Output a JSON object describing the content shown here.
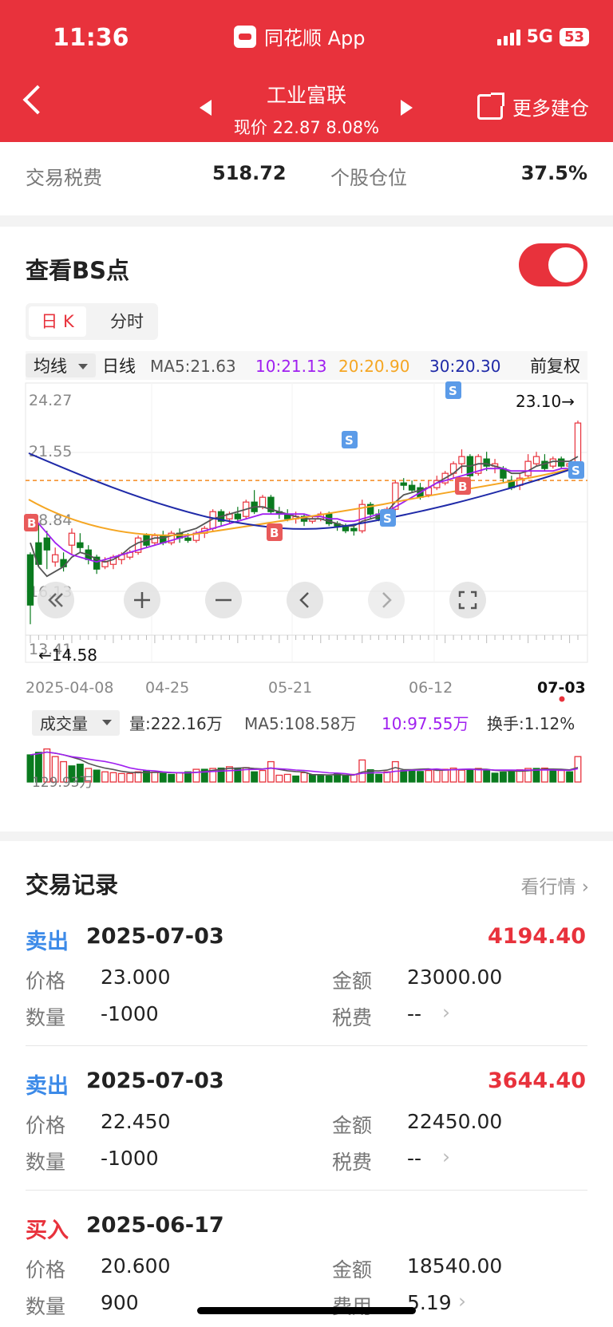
{
  "status_bar": {
    "time": "11:36",
    "app_name": "同花顺 App",
    "network": "5G",
    "battery": "53"
  },
  "header": {
    "stock_name": "工业富联",
    "price_line": "现价 22.87 8.08%",
    "more_label": "更多建仓"
  },
  "stats": {
    "tax_label": "交易税费",
    "tax_value": "518.72",
    "position_label": "个股仓位",
    "position_value": "37.5%"
  },
  "bs_section": {
    "title": "查看BS点",
    "tab_day": "日 K",
    "tab_time": "分时"
  },
  "ma_bar": {
    "avg_label": "均线",
    "period_label": "日线",
    "ma5": "MA5:21.63",
    "ma10": "10:21.13",
    "ma20": "20:20.90",
    "ma30": "30:20.30",
    "adjust_label": "前复权"
  },
  "price_axis": {
    "labels": [
      "24.27",
      "21.55",
      "18.84",
      "16.13",
      "13.41"
    ]
  },
  "annotations": {
    "high": "23.10→",
    "low": "←14.58"
  },
  "date_axis": {
    "labels": [
      "2025-04-08",
      "04-25",
      "05-21",
      "06-12",
      "07-03"
    ]
  },
  "volume_bar": {
    "label": "成交量",
    "volume": "量:222.16万",
    "ma5": "MA5:108.58万",
    "ma10": "10:97.55万",
    "turnover": "换手:1.12%",
    "axis_label": "129.93万"
  },
  "colors": {
    "up": "#e8323c",
    "down": "#0a7a1e",
    "ma5": "#555555",
    "ma10": "#a020f0",
    "ma20": "#f5a623",
    "ma30": "#1f2aa8",
    "buy": "#e85a5a",
    "sell": "#5b9be8"
  },
  "chart_data": {
    "type": "candlestick",
    "start_date": "2025-04-08",
    "end_date": "2025-07-03",
    "price_range": [
      13.41,
      24.27
    ],
    "reference_price": 20.6,
    "candles": [
      [
        17.5,
        15.4,
        17.6,
        14.6
      ],
      [
        18.0,
        17.1,
        18.8,
        17.0
      ],
      [
        18.2,
        17.7,
        18.5,
        16.9
      ],
      [
        17.2,
        17.5,
        17.8,
        17.0
      ],
      [
        17.3,
        17.0,
        17.6,
        16.8
      ],
      [
        17.9,
        18.4,
        18.6,
        17.5
      ],
      [
        18.0,
        17.8,
        18.4,
        17.6
      ],
      [
        17.7,
        17.3,
        17.9,
        17.1
      ],
      [
        17.4,
        16.9,
        17.5,
        16.7
      ],
      [
        17.0,
        17.2,
        17.4,
        16.9
      ],
      [
        17.1,
        17.4,
        17.5,
        16.9
      ],
      [
        17.3,
        17.5,
        17.6,
        17.1
      ],
      [
        17.4,
        17.6,
        17.7,
        17.3
      ],
      [
        17.6,
        18.2,
        18.3,
        17.5
      ],
      [
        18.3,
        17.9,
        18.4,
        17.8
      ],
      [
        18.0,
        18.3,
        18.4,
        17.9
      ],
      [
        18.3,
        18.0,
        18.5,
        17.9
      ],
      [
        18.0,
        18.4,
        18.5,
        17.9
      ],
      [
        18.4,
        18.2,
        18.6,
        18.0
      ],
      [
        18.2,
        18.1,
        18.4,
        18.0
      ],
      [
        18.1,
        18.4,
        18.5,
        18.0
      ],
      [
        18.4,
        18.6,
        18.7,
        18.2
      ],
      [
        18.6,
        19.3,
        19.4,
        18.5
      ],
      [
        19.3,
        18.9,
        19.4,
        18.7
      ],
      [
        19.0,
        19.2,
        19.3,
        18.8
      ],
      [
        19.2,
        19.0,
        19.5,
        18.9
      ],
      [
        19.1,
        19.7,
        19.8,
        19.0
      ],
      [
        19.7,
        19.3,
        20.2,
        19.2
      ],
      [
        19.5,
        19.9,
        20.0,
        19.4
      ],
      [
        19.9,
        19.3,
        20.0,
        19.2
      ],
      [
        19.3,
        19.2,
        19.5,
        19.0
      ],
      [
        19.2,
        19.0,
        19.4,
        18.9
      ],
      [
        19.0,
        19.1,
        19.3,
        18.8
      ],
      [
        19.1,
        18.9,
        19.2,
        18.7
      ],
      [
        18.9,
        19.0,
        19.1,
        18.8
      ],
      [
        19.0,
        19.2,
        19.3,
        18.9
      ],
      [
        19.2,
        18.8,
        19.3,
        18.7
      ],
      [
        18.8,
        18.7,
        18.9,
        18.5
      ],
      [
        18.7,
        18.5,
        18.8,
        18.4
      ],
      [
        18.6,
        18.5,
        18.7,
        18.3
      ],
      [
        18.5,
        19.6,
        19.8,
        18.4
      ],
      [
        19.6,
        19.2,
        19.7,
        19.0
      ],
      [
        19.2,
        19.0,
        19.4,
        18.9
      ],
      [
        19.1,
        19.4,
        19.5,
        19.0
      ],
      [
        19.4,
        20.5,
        20.6,
        19.3
      ],
      [
        20.5,
        20.4,
        20.7,
        20.2
      ],
      [
        20.4,
        20.2,
        20.6,
        20.1
      ],
      [
        20.3,
        19.9,
        20.5,
        19.8
      ],
      [
        20.0,
        20.3,
        20.6,
        19.9
      ],
      [
        20.3,
        20.6,
        20.8,
        20.2
      ],
      [
        20.5,
        20.9,
        21.0,
        20.4
      ],
      [
        20.9,
        21.3,
        21.4,
        20.7
      ],
      [
        21.3,
        21.6,
        21.9,
        20.9
      ],
      [
        21.6,
        20.8,
        21.7,
        20.7
      ],
      [
        20.9,
        21.6,
        21.7,
        20.8
      ],
      [
        21.5,
        21.2,
        21.8,
        21.0
      ],
      [
        21.2,
        21.3,
        21.5,
        20.9
      ],
      [
        21.1,
        20.7,
        21.2,
        20.5
      ],
      [
        20.6,
        20.3,
        20.8,
        20.2
      ],
      [
        20.4,
        20.7,
        20.9,
        20.2
      ],
      [
        20.8,
        21.4,
        21.7,
        20.7
      ],
      [
        21.3,
        21.6,
        21.8,
        21.2
      ],
      [
        21.4,
        21.1,
        21.7,
        21.0
      ],
      [
        21.2,
        21.5,
        21.6,
        21.1
      ],
      [
        21.5,
        21.2,
        21.6,
        21.1
      ],
      [
        21.2,
        21.3,
        21.4,
        21.1
      ],
      [
        21.3,
        23.0,
        23.1,
        21.2
      ]
    ],
    "ma": {
      "ma5": [
        18.0,
        17.0,
        16.6,
        16.8,
        17.0,
        17.4,
        17.6,
        17.5,
        17.3,
        17.2,
        17.3,
        17.5,
        17.8,
        18.0,
        18.1,
        18.2,
        18.2,
        18.3,
        18.4,
        18.5,
        18.6,
        18.8,
        19.0,
        19.1,
        19.2,
        19.3,
        19.4,
        19.5,
        19.5,
        19.4,
        19.3,
        19.2,
        19.1,
        19.0,
        19.0,
        19.0,
        18.9,
        18.8,
        18.7,
        18.7,
        18.9,
        19.0,
        19.1,
        19.3,
        19.7,
        20.0,
        20.1,
        20.2,
        20.3,
        20.5,
        20.7,
        20.9,
        21.2,
        21.2,
        21.3,
        21.3,
        21.2,
        21.1,
        20.9,
        20.9,
        21.0,
        21.2,
        21.3,
        21.4,
        21.4,
        21.4,
        21.6
      ],
      "ma10": [
        19.2,
        18.8,
        18.4,
        18.0,
        17.7,
        17.5,
        17.4,
        17.3,
        17.2,
        17.3,
        17.4,
        17.5,
        17.6,
        17.7,
        17.8,
        17.9,
        18.0,
        18.1,
        18.2,
        18.3,
        18.4,
        18.5,
        18.6,
        18.7,
        18.8,
        18.9,
        19.0,
        19.1,
        19.2,
        19.2,
        19.2,
        19.2,
        19.2,
        19.2,
        19.1,
        19.1,
        19.0,
        19.0,
        18.9,
        18.9,
        19.0,
        19.1,
        19.2,
        19.3,
        19.5,
        19.7,
        19.9,
        20.1,
        20.3,
        20.5,
        20.6,
        20.7,
        20.8,
        20.9,
        21.0,
        21.1,
        21.1,
        21.1,
        21.0,
        21.0,
        21.0,
        21.0,
        21.0,
        21.0,
        21.1,
        21.1,
        21.13
      ]
    },
    "volume_range": [
      0,
      245
    ],
    "volumes": [
      [
        160,
        0
      ],
      [
        175,
        0
      ],
      [
        195,
        1
      ],
      [
        150,
        1
      ],
      [
        120,
        1
      ],
      [
        95,
        0
      ],
      [
        105,
        0
      ],
      [
        80,
        1
      ],
      [
        70,
        0
      ],
      [
        60,
        1
      ],
      [
        55,
        1
      ],
      [
        50,
        1
      ],
      [
        50,
        1
      ],
      [
        60,
        1
      ],
      [
        65,
        0
      ],
      [
        58,
        1
      ],
      [
        50,
        0
      ],
      [
        45,
        0
      ],
      [
        55,
        1
      ],
      [
        60,
        0
      ],
      [
        75,
        1
      ],
      [
        75,
        0
      ],
      [
        80,
        1
      ],
      [
        82,
        0
      ],
      [
        90,
        1
      ],
      [
        82,
        0
      ],
      [
        85,
        1
      ],
      [
        60,
        0
      ],
      [
        68,
        1
      ],
      [
        120,
        1
      ],
      [
        40,
        1
      ],
      [
        45,
        1
      ],
      [
        35,
        0
      ],
      [
        55,
        1
      ],
      [
        42,
        0
      ],
      [
        40,
        0
      ],
      [
        35,
        0
      ],
      [
        50,
        0
      ],
      [
        35,
        0
      ],
      [
        45,
        1
      ],
      [
        130,
        1
      ],
      [
        72,
        0
      ],
      [
        45,
        0
      ],
      [
        60,
        1
      ],
      [
        120,
        1
      ],
      [
        68,
        0
      ],
      [
        70,
        0
      ],
      [
        62,
        0
      ],
      [
        68,
        1
      ],
      [
        75,
        1
      ],
      [
        75,
        1
      ],
      [
        82,
        1
      ],
      [
        70,
        1
      ],
      [
        72,
        0
      ],
      [
        80,
        1
      ],
      [
        70,
        0
      ],
      [
        52,
        0
      ],
      [
        58,
        0
      ],
      [
        68,
        0
      ],
      [
        72,
        1
      ],
      [
        80,
        1
      ],
      [
        80,
        0
      ],
      [
        82,
        1
      ],
      [
        68,
        0
      ],
      [
        68,
        1
      ],
      [
        60,
        0
      ],
      [
        150,
        1
      ]
    ]
  },
  "records": {
    "title": "交易记录",
    "view_market": "看行情",
    "items": [
      {
        "type": "卖出",
        "date": "2025-07-03",
        "pnl": "4194.40",
        "price_label": "价格",
        "price": "23.000",
        "amount_label": "金额",
        "amount": "23000.00",
        "qty_label": "数量",
        "qty": "-1000",
        "fee_label": "税费",
        "fee": "--"
      },
      {
        "type": "卖出",
        "date": "2025-07-03",
        "pnl": "3644.40",
        "price_label": "价格",
        "price": "22.450",
        "amount_label": "金额",
        "amount": "22450.00",
        "qty_label": "数量",
        "qty": "-1000",
        "fee_label": "税费",
        "fee": "--"
      },
      {
        "type": "买入",
        "date": "2025-06-17",
        "pnl": "",
        "price_label": "价格",
        "price": "20.600",
        "amount_label": "金额",
        "amount": "18540.00",
        "qty_label": "数量",
        "qty": "900",
        "fee_label": "费用",
        "fee": "5.19"
      }
    ]
  }
}
